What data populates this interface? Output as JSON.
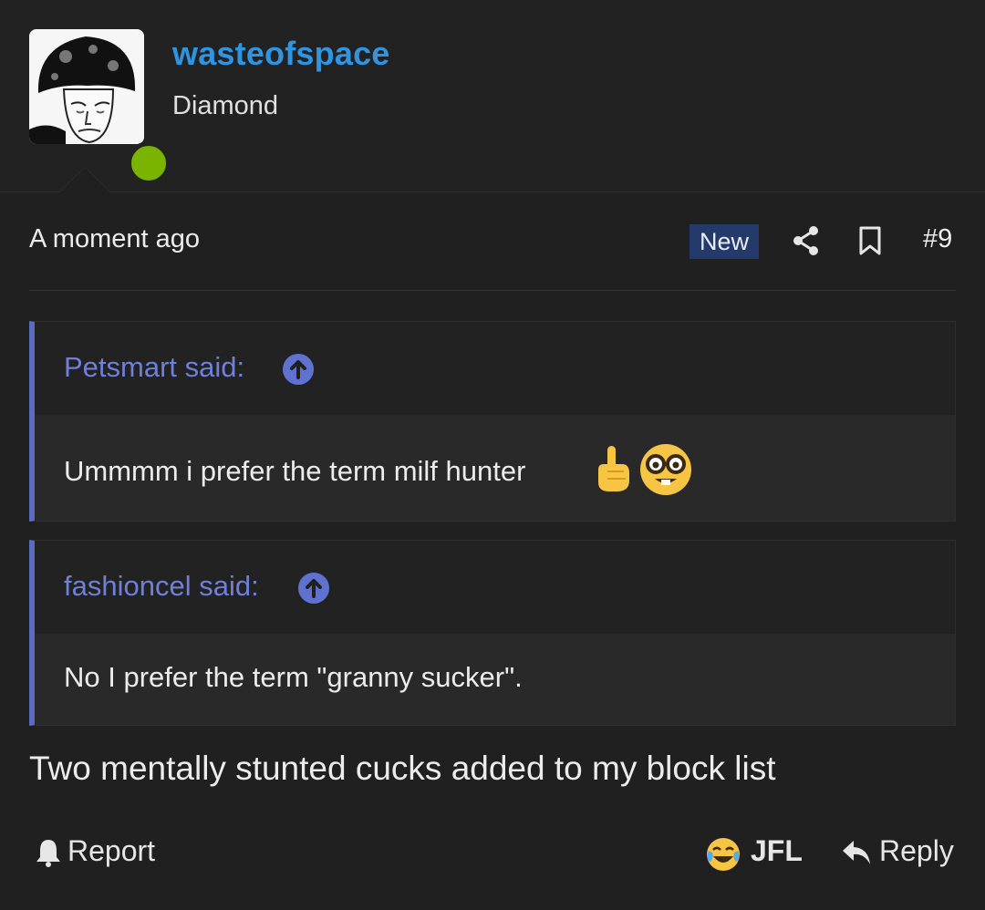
{
  "user": {
    "username": "wasteofspace",
    "title": "Diamond",
    "status_color": "#7ab300",
    "avatar_icon": "mushroom-wojak-avatar"
  },
  "post": {
    "timestamp": "A moment ago",
    "badge": "New",
    "number": "#9",
    "body": "Two mentally stunted cucks added to my block list"
  },
  "quotes": [
    {
      "author": "Petsmart said:",
      "text": "Ummmm i prefer the term milf hunter",
      "emojis": [
        "point-up-emoji",
        "nerd-face-emoji"
      ]
    },
    {
      "author": "fashioncel said:",
      "text": "No I prefer the term \"granny sucker\"."
    }
  ],
  "actions": {
    "report": "Report",
    "reaction": "JFL",
    "reaction_icon": "tears-of-joy-emoji",
    "reply": "Reply"
  },
  "colors": {
    "background": "#202020",
    "username": "#2f95e3",
    "quote_accent": "#5b6bbf",
    "quote_author": "#6f80d8",
    "new_badge": "#243a6b"
  }
}
